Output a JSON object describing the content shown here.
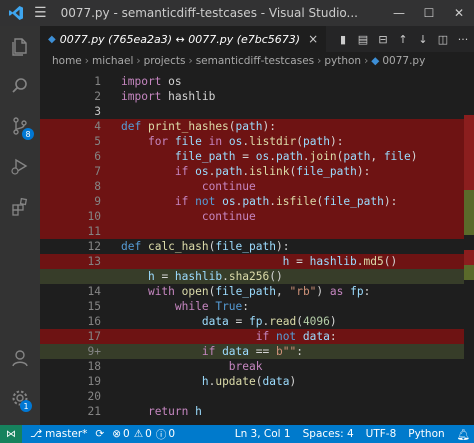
{
  "titlebar": {
    "title": "0077.py - semanticdiff-testcases - Visual Studio...",
    "minimize": "—",
    "maximize": "☐",
    "close": "✕"
  },
  "tab": {
    "label": "0077.py (765ea2a3) ↔ 0077.py (e7bc5673)",
    "close": "×"
  },
  "breadcrumb": [
    "home",
    "michael",
    "projects",
    "semanticdiff-testcases",
    "python",
    "0077.py"
  ],
  "activity_bar": {
    "scm_badge": "8",
    "accounts_badge": "1"
  },
  "editor": {
    "lines": [
      {
        "num": "1",
        "tokens": [
          [
            "k",
            "import"
          ],
          [
            "t",
            " os"
          ]
        ],
        "bg": ""
      },
      {
        "num": "2",
        "tokens": [
          [
            "k",
            "import"
          ],
          [
            "t",
            " hashlib"
          ]
        ],
        "bg": ""
      },
      {
        "num": "3",
        "tokens": [],
        "bg": "",
        "active": true
      },
      {
        "num": "4",
        "tokens": [
          [
            "kb",
            "def"
          ],
          [
            "t",
            " "
          ],
          [
            "f",
            "print_hashes"
          ],
          [
            "t",
            "("
          ],
          [
            "v",
            "path"
          ],
          [
            "t",
            "):"
          ]
        ],
        "bg": "del"
      },
      {
        "num": "5",
        "tokens": [
          [
            "t",
            "    "
          ],
          [
            "k",
            "for"
          ],
          [
            "t",
            " "
          ],
          [
            "v",
            "file"
          ],
          [
            "t",
            " "
          ],
          [
            "k",
            "in"
          ],
          [
            "t",
            " "
          ],
          [
            "v",
            "os"
          ],
          [
            "t",
            "."
          ],
          [
            "f",
            "listdir"
          ],
          [
            "t",
            "("
          ],
          [
            "v",
            "path"
          ],
          [
            "t",
            "):"
          ]
        ],
        "bg": "del"
      },
      {
        "num": "6",
        "tokens": [
          [
            "t",
            "        "
          ],
          [
            "v",
            "file_path"
          ],
          [
            "t",
            " = "
          ],
          [
            "v",
            "os"
          ],
          [
            "t",
            "."
          ],
          [
            "v",
            "path"
          ],
          [
            "t",
            "."
          ],
          [
            "f",
            "join"
          ],
          [
            "t",
            "("
          ],
          [
            "v",
            "path"
          ],
          [
            "t",
            ", "
          ],
          [
            "v",
            "file"
          ],
          [
            "t",
            ")"
          ]
        ],
        "bg": "del"
      },
      {
        "num": "7",
        "tokens": [
          [
            "t",
            "        "
          ],
          [
            "k",
            "if"
          ],
          [
            "t",
            " "
          ],
          [
            "v",
            "os"
          ],
          [
            "t",
            "."
          ],
          [
            "v",
            "path"
          ],
          [
            "t",
            "."
          ],
          [
            "f",
            "islink"
          ],
          [
            "t",
            "("
          ],
          [
            "v",
            "file_path"
          ],
          [
            "t",
            "):"
          ]
        ],
        "bg": "del"
      },
      {
        "num": "8",
        "tokens": [
          [
            "t",
            "            "
          ],
          [
            "k",
            "continue"
          ]
        ],
        "bg": "del"
      },
      {
        "num": "9",
        "tokens": [
          [
            "t",
            "        "
          ],
          [
            "k",
            "if"
          ],
          [
            "t",
            " "
          ],
          [
            "kb",
            "not"
          ],
          [
            "t",
            " "
          ],
          [
            "v",
            "os"
          ],
          [
            "t",
            "."
          ],
          [
            "v",
            "path"
          ],
          [
            "t",
            "."
          ],
          [
            "f",
            "isfile"
          ],
          [
            "t",
            "("
          ],
          [
            "v",
            "file_path"
          ],
          [
            "t",
            "):"
          ]
        ],
        "bg": "del"
      },
      {
        "num": "10",
        "tokens": [
          [
            "t",
            "            "
          ],
          [
            "k",
            "continue"
          ]
        ],
        "bg": "del"
      },
      {
        "num": "11",
        "tokens": [],
        "bg": "del"
      },
      {
        "num": "12",
        "tokens": [
          [
            "kb",
            "def"
          ],
          [
            "t",
            " "
          ],
          [
            "f",
            "calc_hash"
          ],
          [
            "t",
            "("
          ],
          [
            "v",
            "file_path"
          ],
          [
            "t",
            "):"
          ]
        ],
        "bg": ""
      },
      {
        "num": "13",
        "tokens": [
          [
            "t",
            "                        "
          ],
          [
            "v",
            "h"
          ],
          [
            "t",
            " = "
          ],
          [
            "v",
            "hashlib"
          ],
          [
            "t",
            "."
          ],
          [
            "f",
            "md5"
          ],
          [
            "t",
            "()"
          ]
        ],
        "bg": "del"
      },
      {
        "num": "",
        "tokens": [
          [
            "t",
            "    "
          ],
          [
            "v",
            "h"
          ],
          [
            "t",
            " = "
          ],
          [
            "v",
            "hashlib"
          ],
          [
            "t",
            "."
          ],
          [
            "f",
            "sha256"
          ],
          [
            "t",
            "()"
          ]
        ],
        "bg": "ins"
      },
      {
        "num": "14",
        "tokens": [
          [
            "t",
            "    "
          ],
          [
            "k",
            "with"
          ],
          [
            "t",
            " "
          ],
          [
            "f",
            "open"
          ],
          [
            "t",
            "("
          ],
          [
            "v",
            "file_path"
          ],
          [
            "t",
            ", "
          ],
          [
            "s",
            "\"rb\""
          ],
          [
            "t",
            ") "
          ],
          [
            "k",
            "as"
          ],
          [
            "t",
            " "
          ],
          [
            "v",
            "fp"
          ],
          [
            "t",
            ":"
          ]
        ],
        "bg": ""
      },
      {
        "num": "15",
        "tokens": [
          [
            "t",
            "        "
          ],
          [
            "k",
            "while"
          ],
          [
            "t",
            " "
          ],
          [
            "kb",
            "True"
          ],
          [
            "t",
            ":"
          ]
        ],
        "bg": ""
      },
      {
        "num": "16",
        "tokens": [
          [
            "t",
            "            "
          ],
          [
            "v",
            "data"
          ],
          [
            "t",
            " = "
          ],
          [
            "v",
            "fp"
          ],
          [
            "t",
            "."
          ],
          [
            "f",
            "read"
          ],
          [
            "t",
            "("
          ],
          [
            "n",
            "4096"
          ],
          [
            "t",
            ")"
          ]
        ],
        "bg": ""
      },
      {
        "num": "17",
        "tokens": [
          [
            "t",
            "                    "
          ],
          [
            "k",
            "if"
          ],
          [
            "t",
            " "
          ],
          [
            "kb",
            "not"
          ],
          [
            "t",
            " "
          ],
          [
            "v",
            "data"
          ],
          [
            "t",
            ":"
          ]
        ],
        "bg": "del"
      },
      {
        "num": "9+",
        "tokens": [
          [
            "t",
            "            "
          ],
          [
            "k",
            "if"
          ],
          [
            "t",
            " "
          ],
          [
            "v",
            "data"
          ],
          [
            "t",
            " == "
          ],
          [
            "s",
            "b\"\""
          ],
          [
            "t",
            ":"
          ]
        ],
        "bg": "ins"
      },
      {
        "num": "18",
        "tokens": [
          [
            "t",
            "                "
          ],
          [
            "k",
            "break"
          ]
        ],
        "bg": ""
      },
      {
        "num": "19",
        "tokens": [
          [
            "t",
            "            "
          ],
          [
            "v",
            "h"
          ],
          [
            "t",
            "."
          ],
          [
            "f",
            "update"
          ],
          [
            "t",
            "("
          ],
          [
            "v",
            "data"
          ],
          [
            "t",
            ")"
          ]
        ],
        "bg": ""
      },
      {
        "num": "20",
        "tokens": [],
        "bg": ""
      },
      {
        "num": "21",
        "tokens": [
          [
            "t",
            "    "
          ],
          [
            "k",
            "return"
          ],
          [
            "t",
            " "
          ],
          [
            "v",
            "h"
          ]
        ],
        "bg": ""
      }
    ]
  },
  "statusbar": {
    "branch": "master*",
    "sync": "⟳",
    "errors": "0",
    "warnings": "0",
    "info": "0",
    "position": "Ln 3, Col 1",
    "spaces": "Spaces: 4",
    "encoding": "UTF-8",
    "language": "Python"
  },
  "colors": {
    "accent": "#007acc",
    "deleted": "#6e1313",
    "inserted": "#373d29"
  }
}
